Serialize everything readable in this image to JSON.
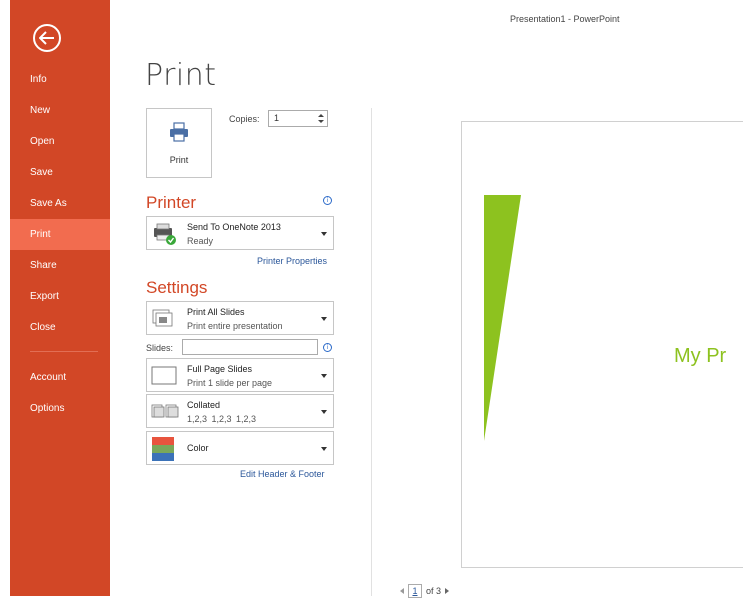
{
  "window": {
    "title": "Presentation1 - PowerPoint"
  },
  "nav": {
    "items": [
      {
        "label": "Info"
      },
      {
        "label": "New"
      },
      {
        "label": "Open"
      },
      {
        "label": "Save"
      },
      {
        "label": "Save As"
      },
      {
        "label": "Print",
        "active": true
      },
      {
        "label": "Share"
      },
      {
        "label": "Export"
      },
      {
        "label": "Close"
      },
      {
        "label": "Account"
      },
      {
        "label": "Options"
      }
    ]
  },
  "page": {
    "title": "Print"
  },
  "print_button": {
    "label": "Print",
    "icon": "printer-icon"
  },
  "copies": {
    "label": "Copies:",
    "value": "1"
  },
  "printer": {
    "heading": "Printer",
    "name": "Send To OneNote 2013",
    "status": "Ready",
    "properties_link": "Printer Properties"
  },
  "settings": {
    "heading": "Settings",
    "slides_range": {
      "main": "Print All Slides",
      "sub": "Print entire presentation"
    },
    "slides_label": "Slides:",
    "slides_value": "",
    "layout": {
      "main": "Full Page Slides",
      "sub": "Print 1 slide per page"
    },
    "collation": {
      "main": "Collated",
      "sub": "1,2,3    1,2,3    1,2,3"
    },
    "color": {
      "main": "Color"
    },
    "header_footer_link": "Edit Header & Footer"
  },
  "preview": {
    "title_text": "My Pr"
  },
  "pager": {
    "current": "1",
    "of_label": "of 3"
  },
  "colors": {
    "accent": "#d24726",
    "active_nav": "#f26c4f",
    "link": "#2b579a",
    "slide_green": "#8dc21f"
  }
}
